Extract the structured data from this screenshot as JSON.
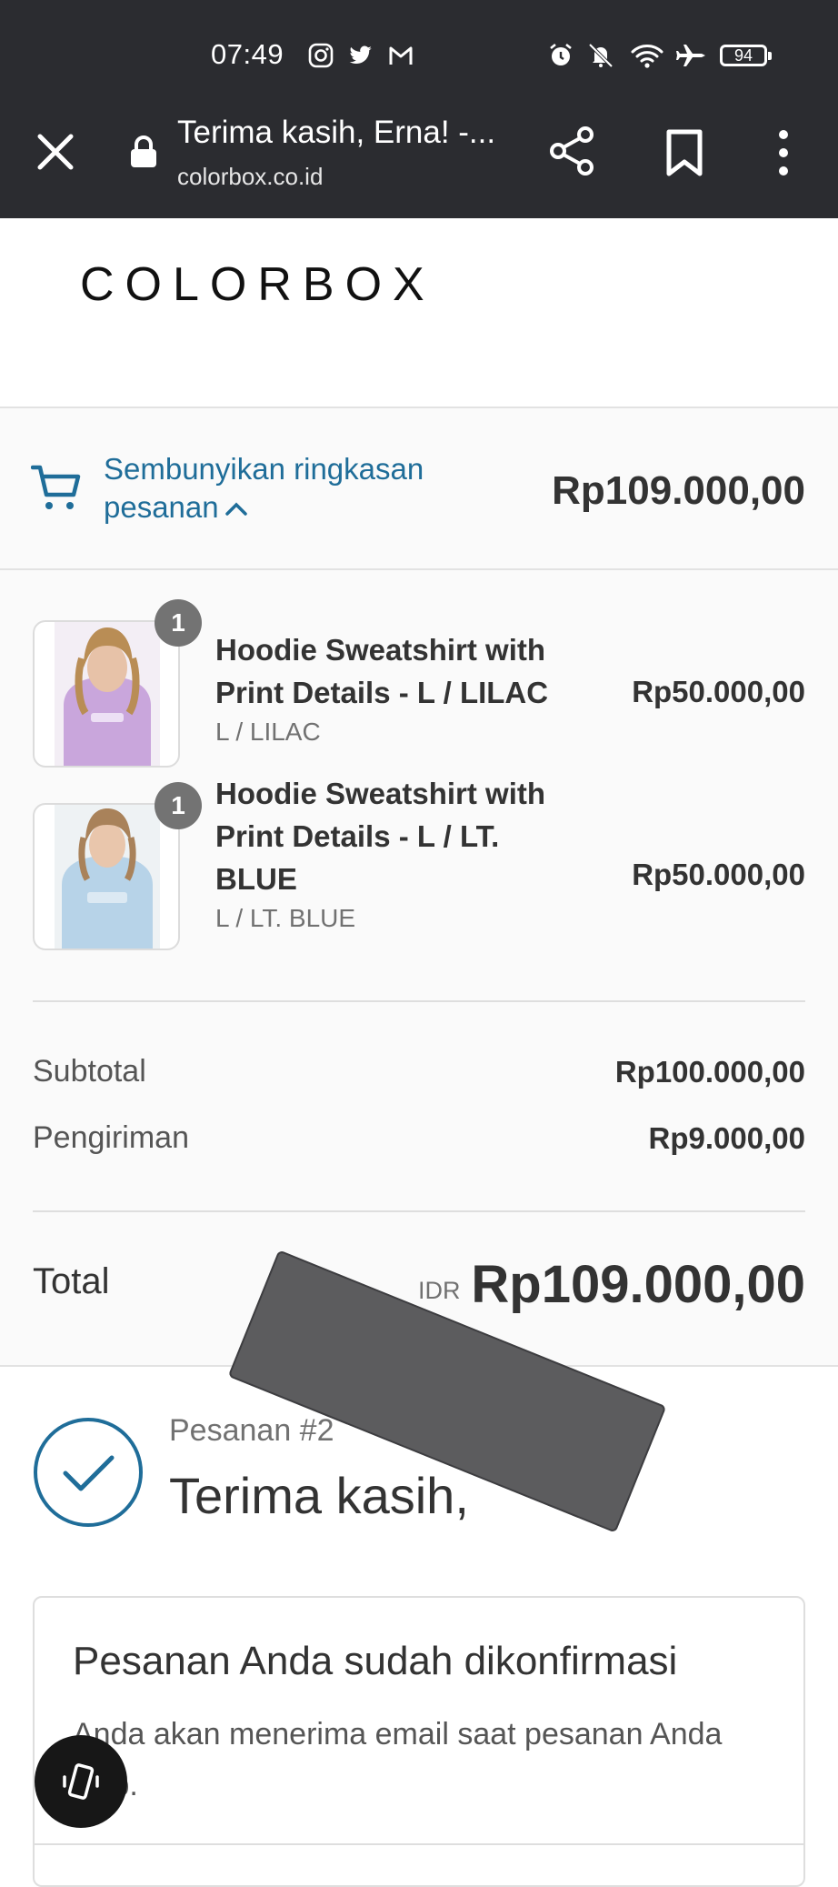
{
  "status_bar": {
    "time": "07:49",
    "left_icons": [
      "instagram-icon",
      "twitter-icon",
      "gmail-icon"
    ],
    "right_icons": [
      "alarm-icon",
      "mute-icon",
      "wifi-icon",
      "airplane-icon"
    ],
    "battery": "94"
  },
  "browser": {
    "title": "Terima kasih, Erna! -...",
    "url": "colorbox.co.id",
    "icons": [
      "close-icon",
      "lock-icon",
      "share-icon",
      "bookmark-icon",
      "more-vert-icon"
    ]
  },
  "brand": {
    "logo": "COLORBOX"
  },
  "summary": {
    "toggle_label": "Sembunyikan ringkasan pesanan",
    "toggle_total": "Rp109.000,00",
    "accent_color": "#1f6d99",
    "items": [
      {
        "quantity": "1",
        "name": "Hoodie Sweatshirt with Print Details - L / LILAC",
        "variant": "L / LILAC",
        "price": "Rp50.000,00",
        "color": "#c9a6dc"
      },
      {
        "quantity": "1",
        "name": "Hoodie Sweatshirt with Print Details - L / LT. BLUE",
        "variant": "L / LT. BLUE",
        "price": "Rp50.000,00",
        "color": "#b7d3e8"
      }
    ],
    "subtotal_label": "Subtotal",
    "subtotal_value": "Rp100.000,00",
    "shipping_label": "Pengiriman",
    "shipping_value": "Rp9.000,00",
    "total_label": "Total",
    "currency": "IDR",
    "total_value": "Rp109.000,00"
  },
  "confirmation": {
    "order_number": "Pesanan #2",
    "thanks": "Terima kasih,",
    "card_title": "Pesanan Anda sudah dikonfirmasi",
    "card_text": "Anda akan menerima email saat pesanan Anda siap."
  }
}
